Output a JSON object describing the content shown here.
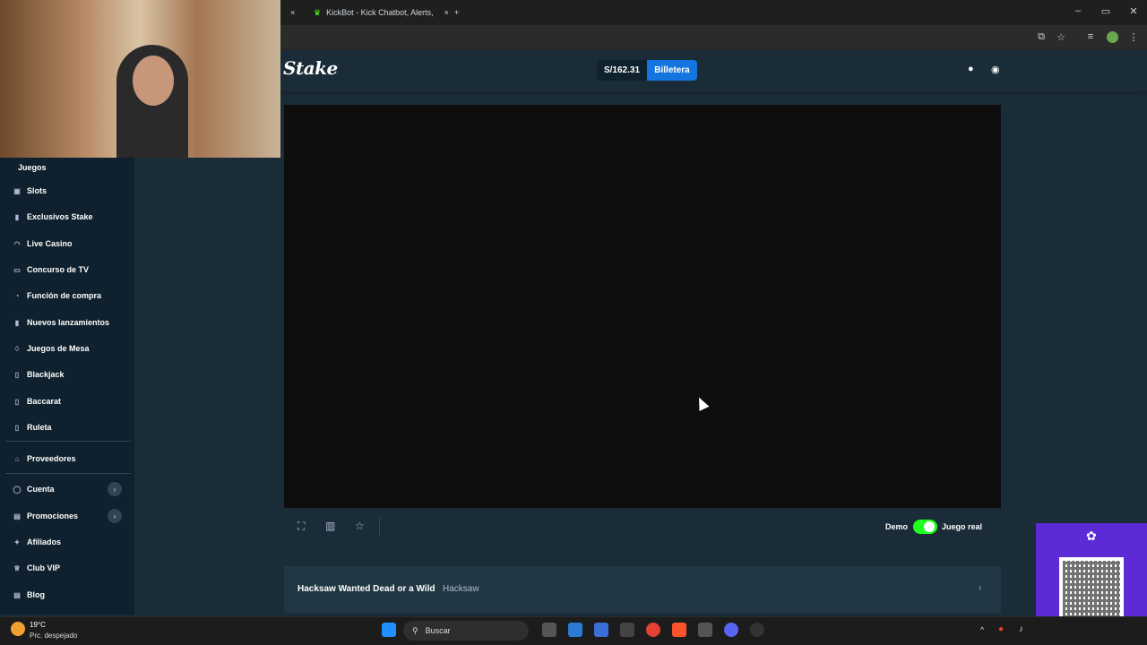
{
  "browser": {
    "tab_title": "KickBot - Kick Chatbot, Alerts,",
    "close_tab_glyph": "×",
    "new_tab_glyph": "+"
  },
  "header": {
    "logo": "Stake",
    "balance": "S/162.31",
    "wallet_label": "Billetera"
  },
  "sidebar": {
    "section_label": "Juegos",
    "items": [
      {
        "label": "Slots",
        "icon": "slots-icon"
      },
      {
        "label": "Exclusivos Stake",
        "icon": "bookmark-icon"
      },
      {
        "label": "Live Casino",
        "icon": "headset-icon"
      },
      {
        "label": "Concurso de TV",
        "icon": "tv-icon"
      },
      {
        "label": "Función de compra",
        "icon": "cart-icon"
      },
      {
        "label": "Nuevos lanzamientos",
        "icon": "new-icon"
      },
      {
        "label": "Juegos de Mesa",
        "icon": "flame-icon"
      },
      {
        "label": "Blackjack",
        "icon": "cards-icon"
      },
      {
        "label": "Baccarat",
        "icon": "cards-icon"
      },
      {
        "label": "Ruleta",
        "icon": "roulette-icon"
      }
    ],
    "providers_label": "Proveedores",
    "lower_items": [
      {
        "label": "Cuenta",
        "icon": "user-icon"
      },
      {
        "label": "Promociones",
        "icon": "gift-icon"
      },
      {
        "label": "Afiliados",
        "icon": "affiliate-icon"
      },
      {
        "label": "Club VIP",
        "icon": "trophy-icon"
      },
      {
        "label": "Blog",
        "icon": "blog-icon"
      }
    ]
  },
  "game": {
    "demo_label": "Demo",
    "real_label": "Juego real",
    "title": "Hacksaw Wanted Dead or a Wild",
    "provider": "Hacksaw",
    "real_mode_on": true
  },
  "taskbar": {
    "temperature": "19°C",
    "weather": "Prc. despejado",
    "search_label": "Buscar"
  },
  "colors": {
    "accent": "#1475e1",
    "toggle_on": "#1fff20",
    "sidebar_bg": "#0f212e",
    "page_bg": "#1a2c38"
  }
}
